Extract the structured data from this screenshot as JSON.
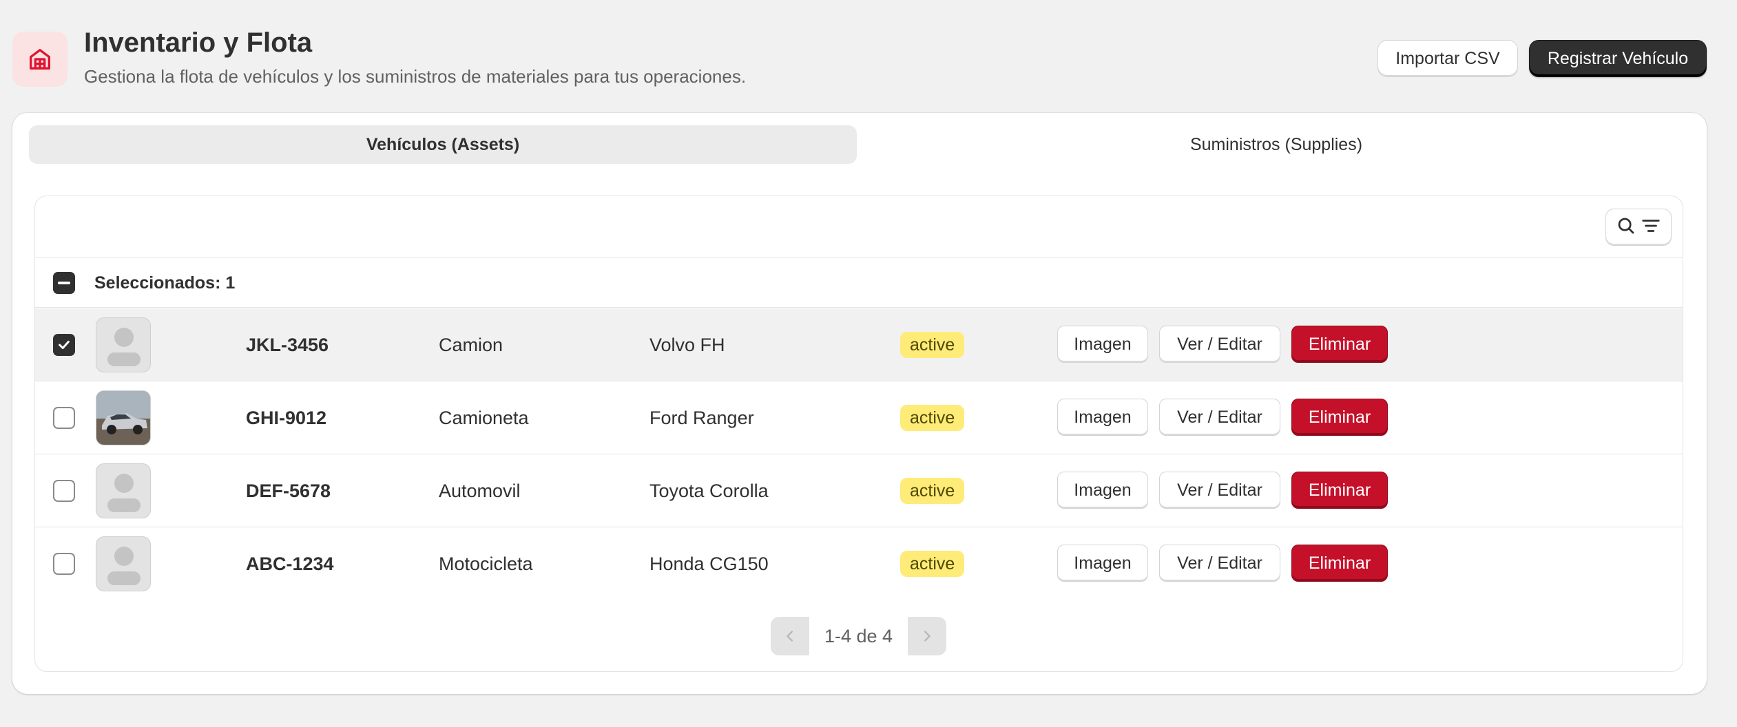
{
  "header": {
    "title": "Inventario y Flota",
    "subtitle": "Gestiona la flota de vehículos y los suministros de materiales para tus operaciones.",
    "icon": "store-icon",
    "import_label": "Importar CSV",
    "register_label": "Registrar Vehículo"
  },
  "tabs": [
    {
      "label": "Vehículos (Assets)",
      "active": true
    },
    {
      "label": "Suministros (Supplies)",
      "active": false
    }
  ],
  "table": {
    "selected_label": "Seleccionados: 1",
    "rows": [
      {
        "plate": "JKL-3456",
        "type": "Camion",
        "model": "Volvo FH",
        "status": "active",
        "selected": true,
        "image": "placeholder-avatar"
      },
      {
        "plate": "GHI-9012",
        "type": "Camioneta",
        "model": "Ford Ranger",
        "status": "active",
        "selected": false,
        "image": "vehicle-photo"
      },
      {
        "plate": "DEF-5678",
        "type": "Automovil",
        "model": "Toyota Corolla",
        "status": "active",
        "selected": false,
        "image": "placeholder-avatar"
      },
      {
        "plate": "ABC-1234",
        "type": "Motocicleta",
        "model": "Honda CG150",
        "status": "active",
        "selected": false,
        "image": "placeholder-avatar"
      }
    ],
    "actions": {
      "image_label": "Imagen",
      "edit_label": "Ver / Editar",
      "delete_label": "Eliminar"
    }
  },
  "pagination": {
    "label": "1-4 de 4"
  },
  "colors": {
    "primary": "#303030",
    "danger": "#c5102a",
    "badge_bg": "#ffeb78",
    "header_icon_bg": "#fbe3e3",
    "header_icon_fg": "#e0132e"
  }
}
